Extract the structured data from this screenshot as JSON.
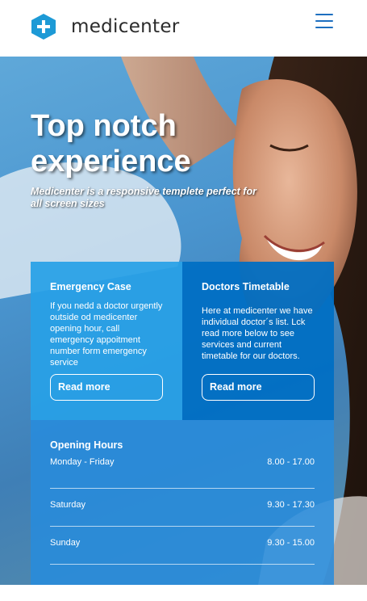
{
  "header": {
    "brand": "medicenter",
    "logo_icon": "medical-cross-hexagon-icon",
    "menu_icon": "hamburger-menu-icon",
    "accent_color": "#1d9ad6"
  },
  "hero": {
    "title": "Top notch experience",
    "subtitle": "Medicenter is a responsive templete perfect for all screen sizes"
  },
  "cards": {
    "emergency": {
      "title": "Emergency Case",
      "text": "If you nedd a doctor urgently outside od medicenter opening hour, call emergency appoitment number form emergency service",
      "button": "Read more"
    },
    "timetable": {
      "title": "Doctors Timetable",
      "text": "Here at medicenter we have individual doctor´s list. Lck read more below to see services and current timetable for our doctors.",
      "button": "Read more"
    }
  },
  "hours": {
    "title": "Opening Hours",
    "rows": [
      {
        "day": "Monday - Friday",
        "time": "8.00 - 17.00"
      },
      {
        "day": "Saturday",
        "time": "9.30 - 17.30"
      },
      {
        "day": "Sunday",
        "time": "9.30 - 15.00"
      }
    ]
  }
}
